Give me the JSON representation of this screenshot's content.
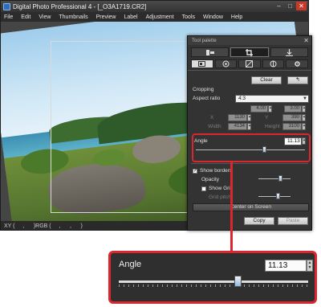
{
  "window": {
    "title": "Digital Photo Professional 4 - [_O3A1719.CR2]",
    "controls": {
      "minimize": "–",
      "maximize": "□",
      "close": "✕"
    }
  },
  "menu": [
    "File",
    "Edit",
    "View",
    "Thumbnails",
    "Preview",
    "Label",
    "Adjustment",
    "Tools",
    "Window",
    "Help"
  ],
  "status": {
    "text": "XY (     ,      )RGB (     ,      ,      )"
  },
  "palette": {
    "title": "Tool palette",
    "close": "✕",
    "top_tabs": [
      "basic-adjust-tab",
      "crop-tool-tab",
      "export-tab"
    ],
    "sub_tabs": [
      "tone-tab",
      "lens-tab",
      "crop-tab",
      "color-tab",
      "settings-tab"
    ],
    "clear_label": "Clear",
    "undo_label": "↰",
    "cropping_label": "Cropping",
    "aspect_ratio_label": "Aspect ratio",
    "aspect_ratio_value": "4:3",
    "ratio_w": "4.00",
    "ratio_h": "3.00",
    "x_label": "X",
    "x_value": "1130",
    "y_label": "Y",
    "y_value": "390",
    "width_label": "Width",
    "width_value": "4134",
    "height_label": "Height",
    "height_value": "3100",
    "angle_label": "Angle",
    "angle_value": "11.13",
    "show_borders_label": "Show borders",
    "opacity_label": "Opacity",
    "show_grid_label": "Show Grid",
    "grid_pitch_label": "Grid pitch",
    "center_on_screen_label": "Center on Screen",
    "copy_label": "Copy",
    "paste_label": "Paste",
    "check_mark": "✓",
    "spin_up": "▲",
    "spin_down": "▼"
  },
  "zoom": {
    "angle_label": "Angle",
    "angle_value": "11.13",
    "angle_slider_fraction": 0.63
  },
  "colors": {
    "highlight": "#d9262f",
    "panel_bg": "#333333",
    "window_bg": "#3a3a3a"
  }
}
